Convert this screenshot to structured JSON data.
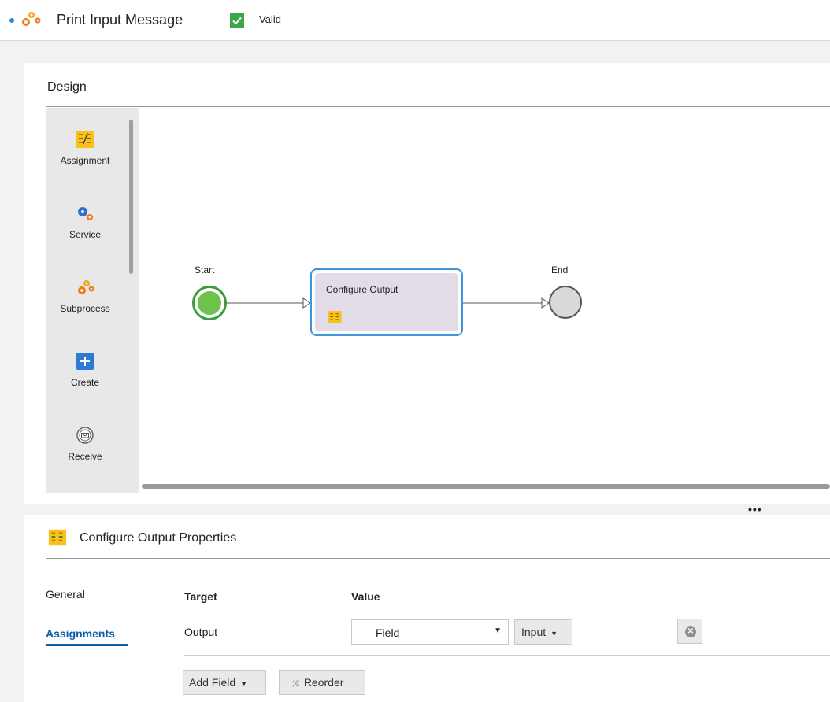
{
  "header": {
    "title": "Print Input Message",
    "status": "Valid",
    "colors": {
      "status_ok": "#3aa84a",
      "accent": "#2a8bd8"
    }
  },
  "design": {
    "title": "Design",
    "palette": [
      {
        "label": "Assignment",
        "icon": "assignment-icon"
      },
      {
        "label": "Service",
        "icon": "service-icon"
      },
      {
        "label": "Subprocess",
        "icon": "subprocess-icon"
      },
      {
        "label": "Create",
        "icon": "create-icon"
      },
      {
        "label": "Receive",
        "icon": "receive-icon"
      }
    ],
    "nodes": {
      "start_label": "Start",
      "step_label": "Configure Output",
      "end_label": "End"
    },
    "more_label": "•••"
  },
  "properties": {
    "title": "Configure Output Properties",
    "tabs": [
      {
        "label": "General",
        "active": false
      },
      {
        "label": "Assignments",
        "active": true
      }
    ],
    "columns": {
      "target": "Target",
      "value": "Value"
    },
    "rows": [
      {
        "target": "Output",
        "value_type": "Field",
        "value_source": "Input"
      }
    ],
    "buttons": {
      "add_field": "Add Field",
      "reorder": "Reorder"
    }
  }
}
